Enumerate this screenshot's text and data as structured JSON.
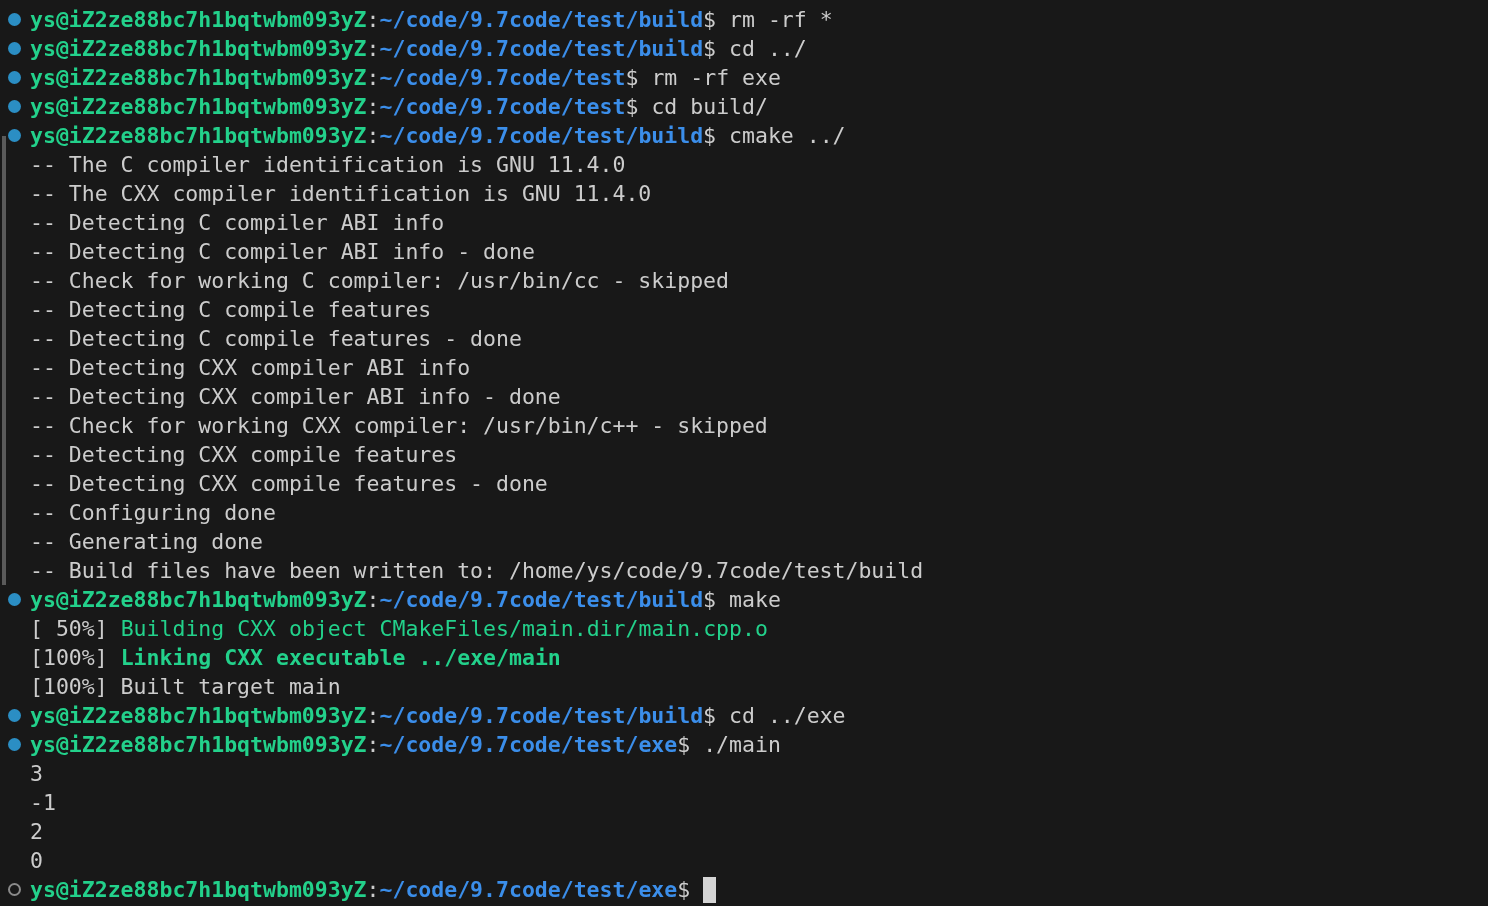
{
  "terminal": {
    "blocks": [
      {
        "user": "ys@iZ2ze88bc7h1bqtwbm093yZ",
        "separator": ":",
        "path": "~/code/9.7code/test/build",
        "prompt_char": "$",
        "command": "rm -rf *",
        "completed": true,
        "highlighted": false
      },
      {
        "user": "ys@iZ2ze88bc7h1bqtwbm093yZ",
        "separator": ":",
        "path": "~/code/9.7code/test/build",
        "prompt_char": "$",
        "command": "cd ../",
        "completed": true,
        "highlighted": false
      },
      {
        "user": "ys@iZ2ze88bc7h1bqtwbm093yZ",
        "separator": ":",
        "path": "~/code/9.7code/test",
        "prompt_char": "$",
        "command": "rm -rf exe",
        "completed": true,
        "highlighted": false
      },
      {
        "user": "ys@iZ2ze88bc7h1bqtwbm093yZ",
        "separator": ":",
        "path": "~/code/9.7code/test",
        "prompt_char": "$",
        "command": "cd build/",
        "completed": true,
        "highlighted": false
      },
      {
        "user": "ys@iZ2ze88bc7h1bqtwbm093yZ",
        "separator": ":",
        "path": "~/code/9.7code/test/build",
        "prompt_char": "$",
        "command": "cmake ../",
        "completed": true,
        "highlighted": true,
        "output": [
          "-- The C compiler identification is GNU 11.4.0",
          "-- The CXX compiler identification is GNU 11.4.0",
          "-- Detecting C compiler ABI info",
          "-- Detecting C compiler ABI info - done",
          "-- Check for working C compiler: /usr/bin/cc - skipped",
          "-- Detecting C compile features",
          "-- Detecting C compile features - done",
          "-- Detecting CXX compiler ABI info",
          "-- Detecting CXX compiler ABI info - done",
          "-- Check for working CXX compiler: /usr/bin/c++ - skipped",
          "-- Detecting CXX compile features",
          "-- Detecting CXX compile features - done",
          "-- Configuring done",
          "-- Generating done",
          "-- Build files have been written to: /home/ys/code/9.7code/test/build"
        ]
      },
      {
        "user": "ys@iZ2ze88bc7h1bqtwbm093yZ",
        "separator": ":",
        "path": "~/code/9.7code/test/build",
        "prompt_char": "$",
        "command": "make",
        "completed": true,
        "highlighted": false,
        "output": [
          {
            "progress": "[ 50%]",
            "message": "Building CXX object CMakeFiles/main.dir/main.cpp.o",
            "bold": false
          },
          {
            "progress": "[100%]",
            "message": "Linking CXX executable ../exe/main",
            "bold": true
          },
          "[100%] Built target main"
        ]
      },
      {
        "user": "ys@iZ2ze88bc7h1bqtwbm093yZ",
        "separator": ":",
        "path": "~/code/9.7code/test/build",
        "prompt_char": "$",
        "command": "cd ../exe",
        "completed": true,
        "highlighted": false
      },
      {
        "user": "ys@iZ2ze88bc7h1bqtwbm093yZ",
        "separator": ":",
        "path": "~/code/9.7code/test/exe",
        "prompt_char": "$",
        "command": "./main",
        "completed": true,
        "highlighted": false,
        "output": [
          "3",
          "-1",
          "2",
          "0"
        ]
      },
      {
        "user": "ys@iZ2ze88bc7h1bqtwbm093yZ",
        "separator": ":",
        "path": "~/code/9.7code/test/exe",
        "prompt_char": "$",
        "completed": false,
        "highlighted": false
      }
    ]
  }
}
